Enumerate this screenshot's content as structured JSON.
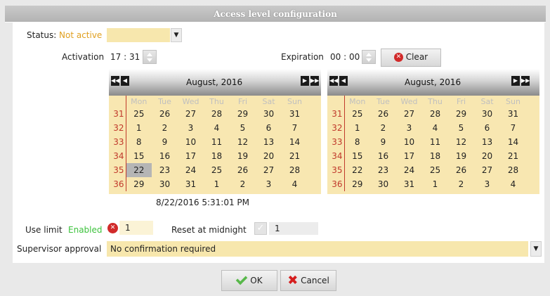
{
  "window": {
    "title": "Access level configuration"
  },
  "status": {
    "label": "Status:",
    "value": "Not active",
    "value_color": "#e0a020"
  },
  "activation": {
    "label": "Activation",
    "time": "17 : 31"
  },
  "expiration": {
    "label": "Expiration",
    "time": "00 : 00",
    "clear_label": "Clear"
  },
  "calendars": [
    {
      "month": "August, 2016",
      "days": [
        "Mon",
        "Tue",
        "Wed",
        "Thu",
        "Fri",
        "Sat",
        "Sun"
      ],
      "weeks": [
        {
          "no": "31",
          "d": [
            "25",
            "26",
            "27",
            "28",
            "29",
            "30",
            "31"
          ]
        },
        {
          "no": "32",
          "d": [
            "1",
            "2",
            "3",
            "4",
            "5",
            "6",
            "7"
          ]
        },
        {
          "no": "33",
          "d": [
            "8",
            "9",
            "10",
            "11",
            "12",
            "13",
            "14"
          ]
        },
        {
          "no": "34",
          "d": [
            "15",
            "16",
            "17",
            "18",
            "19",
            "20",
            "21"
          ]
        },
        {
          "no": "35",
          "d": [
            "22",
            "23",
            "24",
            "25",
            "26",
            "27",
            "28"
          ]
        },
        {
          "no": "36",
          "d": [
            "29",
            "30",
            "31",
            "1",
            "2",
            "3",
            "4"
          ]
        }
      ],
      "selected": "22"
    },
    {
      "month": "August, 2016",
      "days": [
        "Mon",
        "Tue",
        "Wed",
        "Thu",
        "Fri",
        "Sat",
        "Sun"
      ],
      "weeks": [
        {
          "no": "31",
          "d": [
            "25",
            "26",
            "27",
            "28",
            "29",
            "30",
            "31"
          ]
        },
        {
          "no": "32",
          "d": [
            "1",
            "2",
            "3",
            "4",
            "5",
            "6",
            "7"
          ]
        },
        {
          "no": "33",
          "d": [
            "8",
            "9",
            "10",
            "11",
            "12",
            "13",
            "14"
          ]
        },
        {
          "no": "34",
          "d": [
            "15",
            "16",
            "17",
            "18",
            "19",
            "20",
            "21"
          ]
        },
        {
          "no": "35",
          "d": [
            "22",
            "23",
            "24",
            "25",
            "26",
            "27",
            "28"
          ]
        },
        {
          "no": "36",
          "d": [
            "29",
            "30",
            "31",
            "1",
            "2",
            "3",
            "4"
          ]
        }
      ],
      "selected": ""
    }
  ],
  "datetime_display": "8/22/2016 5:31:01 PM",
  "use_limit": {
    "label": "Use limit",
    "state": "Enabled",
    "state_color": "#3cc23c",
    "value": "1"
  },
  "reset": {
    "label": "Reset at midnight",
    "value": "1"
  },
  "supervisor": {
    "label": "Supervisor approval",
    "value": "No confirmation required"
  },
  "buttons": {
    "ok": "OK",
    "cancel": "Cancel"
  },
  "colors": {
    "accent_yellow": "#f8e7b1",
    "week_red": "#c0392b"
  }
}
